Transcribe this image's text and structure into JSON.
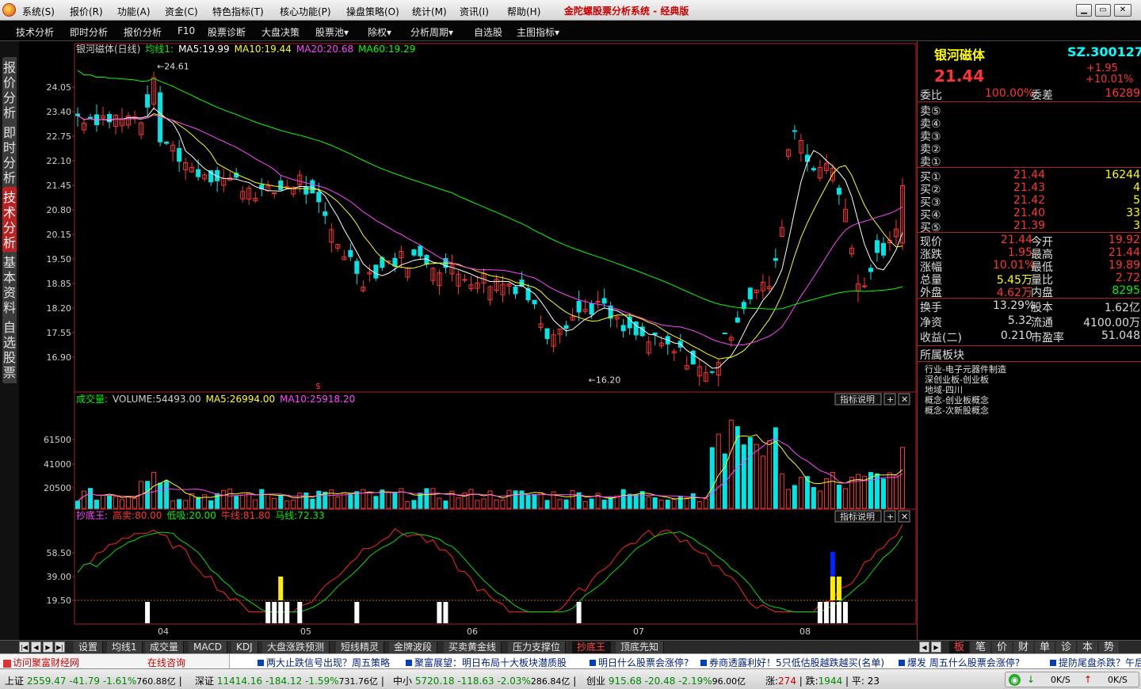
{
  "app": {
    "title": "金陀螺股票分析系统 - 经典版",
    "menu": [
      "系统(S)",
      "报价(R)",
      "功能(A)",
      "资金(C)",
      "特色指标(T)",
      "核心功能(P)",
      "操盘策略(O)",
      "统计(M)",
      "资讯(I)",
      "帮助(H)"
    ],
    "window_buttons": [
      "▁",
      "▭",
      "✕"
    ]
  },
  "toolbar": [
    "技术分析",
    "即时分析",
    "报价分析",
    "F10",
    "股票诊断",
    "大盘决策",
    "股票池▾",
    "除权▾",
    "分析周期▾",
    "自选股",
    "主图指标▾"
  ],
  "side_tabs": [
    {
      "label": "报价分析",
      "active": false
    },
    {
      "label": "即时分析",
      "active": false
    },
    {
      "label": "技术分析",
      "active": true
    },
    {
      "label": "基本资料",
      "active": false
    },
    {
      "label": "自选股票",
      "active": false
    }
  ],
  "main_panel": {
    "header_parts": [
      {
        "text": "银河磁体(日线)",
        "color": "#d0d0d0"
      },
      {
        "text": "均线1:",
        "color": "#00ee00"
      },
      {
        "text": "MA5:19.99",
        "color": "#ffffff"
      },
      {
        "text": "MA10:19.44",
        "color": "#ffff00"
      },
      {
        "text": "MA20:20.68",
        "color": "#ff44ff"
      },
      {
        "text": "MA60:19.29",
        "color": "#00ff00"
      }
    ],
    "y_labels": [
      "24.05",
      "23.40",
      "22.75",
      "22.10",
      "21.45",
      "20.80",
      "20.15",
      "19.50",
      "18.85",
      "18.20",
      "17.55",
      "16.90"
    ],
    "high_label": "←24.61",
    "low_label": "←16.20",
    "marker": "$"
  },
  "volume_panel": {
    "header_parts": [
      {
        "text": "成交量:",
        "color": "#00ee00"
      },
      {
        "text": "VOLUME:54493.00",
        "color": "#d0d0d0"
      },
      {
        "text": "MA5:26994.00",
        "color": "#ffff00"
      },
      {
        "text": "MA10:25918.20",
        "color": "#ff44ff"
      }
    ],
    "y_labels": [
      "61500",
      "41000",
      "20500"
    ],
    "button_label": "指标说明",
    "small_buttons": [
      "+",
      "✕"
    ]
  },
  "indicator_panel": {
    "header_parts": [
      {
        "text": "抄底王:",
        "color": "#ff44ff"
      },
      {
        "text": "高卖:80.00",
        "color": "#ff3333"
      },
      {
        "text": "低吸:20.00",
        "color": "#00ee00"
      },
      {
        "text": "牛线:81.80",
        "color": "#ff3333"
      },
      {
        "text": "马线:72.33",
        "color": "#00ee00"
      }
    ],
    "y_labels": [
      "58.50",
      "39.00",
      "19.50"
    ],
    "button_label": "指标说明",
    "small_buttons": [
      "+",
      "✕"
    ]
  },
  "x_labels": [
    "04",
    "05",
    "06",
    "07",
    "08"
  ],
  "bottom_tabs": {
    "items": [
      "设置",
      "均线1",
      "成交量",
      "MACD",
      "KDJ",
      "大盘涨跌预测",
      "短线精灵",
      "金牌波段",
      "买卖黄金线",
      "压力支撑位",
      "抄底王",
      "顶底先知"
    ],
    "active": "抄底王",
    "right_items": [
      "板",
      "笔",
      "价",
      "财",
      "单",
      "诊",
      "本",
      "势"
    ],
    "right_active": "板"
  },
  "quote": {
    "name": "银河磁体",
    "code": "SZ.300127",
    "price": "21.44",
    "change": "+1.95",
    "change_pct": "+10.01%",
    "weibi_label": "委比",
    "weibi": "100.00%",
    "weicha_label": "委差",
    "weicha": "16289",
    "asks": [
      {
        "label": "卖⑤",
        "price": "",
        "vol": ""
      },
      {
        "label": "卖④",
        "price": "",
        "vol": ""
      },
      {
        "label": "卖③",
        "price": "",
        "vol": ""
      },
      {
        "label": "卖②",
        "price": "",
        "vol": ""
      },
      {
        "label": "卖①",
        "price": "",
        "vol": ""
      }
    ],
    "bids": [
      {
        "label": "买①",
        "price": "21.44",
        "vol": "16244"
      },
      {
        "label": "买②",
        "price": "21.43",
        "vol": "4"
      },
      {
        "label": "买③",
        "price": "21.42",
        "vol": "5"
      },
      {
        "label": "买④",
        "price": "21.40",
        "vol": "33"
      },
      {
        "label": "买⑤",
        "price": "21.39",
        "vol": "3"
      }
    ],
    "stats": [
      {
        "l1": "现价",
        "v1": "21.44",
        "c1": "#ff3333",
        "l2": "今开",
        "v2": "19.92",
        "c2": "#ff3333"
      },
      {
        "l1": "涨跌",
        "v1": "1.95",
        "c1": "#ff3333",
        "l2": "最高",
        "v2": "21.44",
        "c2": "#ff3333"
      },
      {
        "l1": "涨幅",
        "v1": "10.01%",
        "c1": "#ff3333",
        "l2": "最低",
        "v2": "19.89",
        "c2": "#ff3333"
      },
      {
        "l1": "总量",
        "v1": "5.45万",
        "c1": "#ffff00",
        "l2": "量比",
        "v2": "2.72",
        "c2": "#ff3333"
      },
      {
        "l1": "外盘",
        "v1": "4.62万",
        "c1": "#ff3333",
        "l2": "内盘",
        "v2": "8295",
        "c2": "#00ee00"
      }
    ],
    "stats2": [
      {
        "l1": "换手",
        "v1": "13.29%",
        "l2": "股本",
        "v2": "1.62亿"
      },
      {
        "l1": "净资",
        "v1": "5.32",
        "l2": "流通",
        "v2": "4100.00万"
      },
      {
        "l1": "收益(二)",
        "v1": "0.210",
        "l2": "市盈率",
        "v2": "51.048"
      }
    ],
    "sector_title": "所属板块",
    "sectors": [
      "行业-电子元器件制造",
      "深创业板-创业板",
      "地域-四川",
      "概念-创业板概念",
      "概念-次新股概念"
    ]
  },
  "news": {
    "left1": "访问聚富财经网",
    "left2": "在线咨询",
    "items": [
      "两大止跌信号出现？周五策略",
      "聚富展望：明日布局十大板块潜质股",
      "明日什么股票会涨停?",
      "券商透露利好！5只低估股越跌越买(名单)",
      "爆发  周五什么股票会涨停?",
      "提防尾盘杀跌？午后"
    ]
  },
  "status": {
    "items": [
      {
        "label": "上证",
        "value": "2559.47",
        "chg": "-41.79",
        "pct": "-1.61%",
        "amt": "760.88亿"
      },
      {
        "label": "深证",
        "value": "11414.16",
        "chg": "-184.12",
        "pct": "-1.59%",
        "amt": "731.76亿"
      },
      {
        "label": "中小",
        "value": "5720.18",
        "chg": "-118.63",
        "pct": "-2.03%",
        "amt": "286.84亿"
      },
      {
        "label": "创业",
        "value": "915.68",
        "chg": "-20.48",
        "pct": "-2.19%",
        "amt": "96.00亿"
      }
    ],
    "zhang_label": "涨:",
    "zhang": "274",
    "die_label": "跌:",
    "die": "1944",
    "ping_label": "平:",
    "ping": "23",
    "net1": "0K/S",
    "net2": "0K/S"
  },
  "colors": {
    "up": "#ff3333",
    "down": "#00e5e5",
    "ma5": "#ffffff",
    "ma10": "#ffff00",
    "ma20": "#ff44ff",
    "ma60": "#00ff00",
    "border": "#aa2222"
  }
}
